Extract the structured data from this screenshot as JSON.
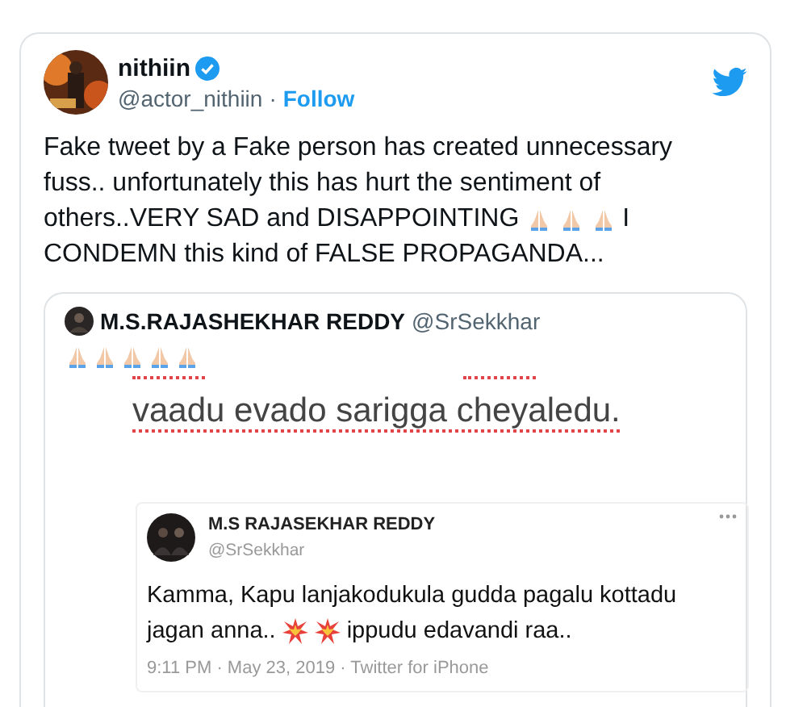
{
  "tweet": {
    "name": "nithiin",
    "verified": true,
    "handle": "@actor_nithiin",
    "separator": "·",
    "follow": "Follow",
    "body": [
      {
        "segments": [
          {
            "kind": "text",
            "text": "Fake tweet by a Fake person has created unnecessary"
          }
        ]
      },
      {
        "segments": [
          {
            "kind": "text",
            "text": "fuss.. unfortunately this has hurt the sentiment of"
          }
        ]
      },
      {
        "segments": [
          {
            "kind": "text",
            "text": "others..VERY SAD and DISAPPOINTING"
          },
          {
            "kind": "pray"
          },
          {
            "kind": "pray"
          },
          {
            "kind": "pray"
          },
          {
            "kind": "text",
            "text": "I"
          }
        ]
      },
      {
        "segments": [
          {
            "kind": "text",
            "text": "CONDEMN this kind of FALSE PROPAGANDA..."
          }
        ]
      }
    ],
    "quote": {
      "name": "M.S.RAJASHEKHAR REDDY",
      "handle": "@SrSekkhar",
      "emoji": [
        {
          "kind": "pray"
        },
        {
          "kind": "pray"
        },
        {
          "kind": "pray"
        },
        {
          "kind": "pray"
        },
        {
          "kind": "pray"
        }
      ],
      "image_text": "vaadu evado sarigga cheyaledu.",
      "embedded": {
        "name": "M.S RAJASEKHAR REDDY",
        "handle": "@SrSekkhar",
        "body": [
          {
            "segments": [
              {
                "kind": "text",
                "text": "Kamma, Kapu lanjakodukula gudda pagalu kottadu"
              }
            ]
          },
          {
            "segments": [
              {
                "kind": "text",
                "text": "jagan anna.."
              },
              {
                "kind": "collision"
              },
              {
                "kind": "collision"
              },
              {
                "kind": "text",
                "text": "ippudu edavandi raa.."
              }
            ]
          }
        ],
        "meta": "9:11 PM · May 23, 2019 · Twitter for iPhone"
      }
    }
  }
}
